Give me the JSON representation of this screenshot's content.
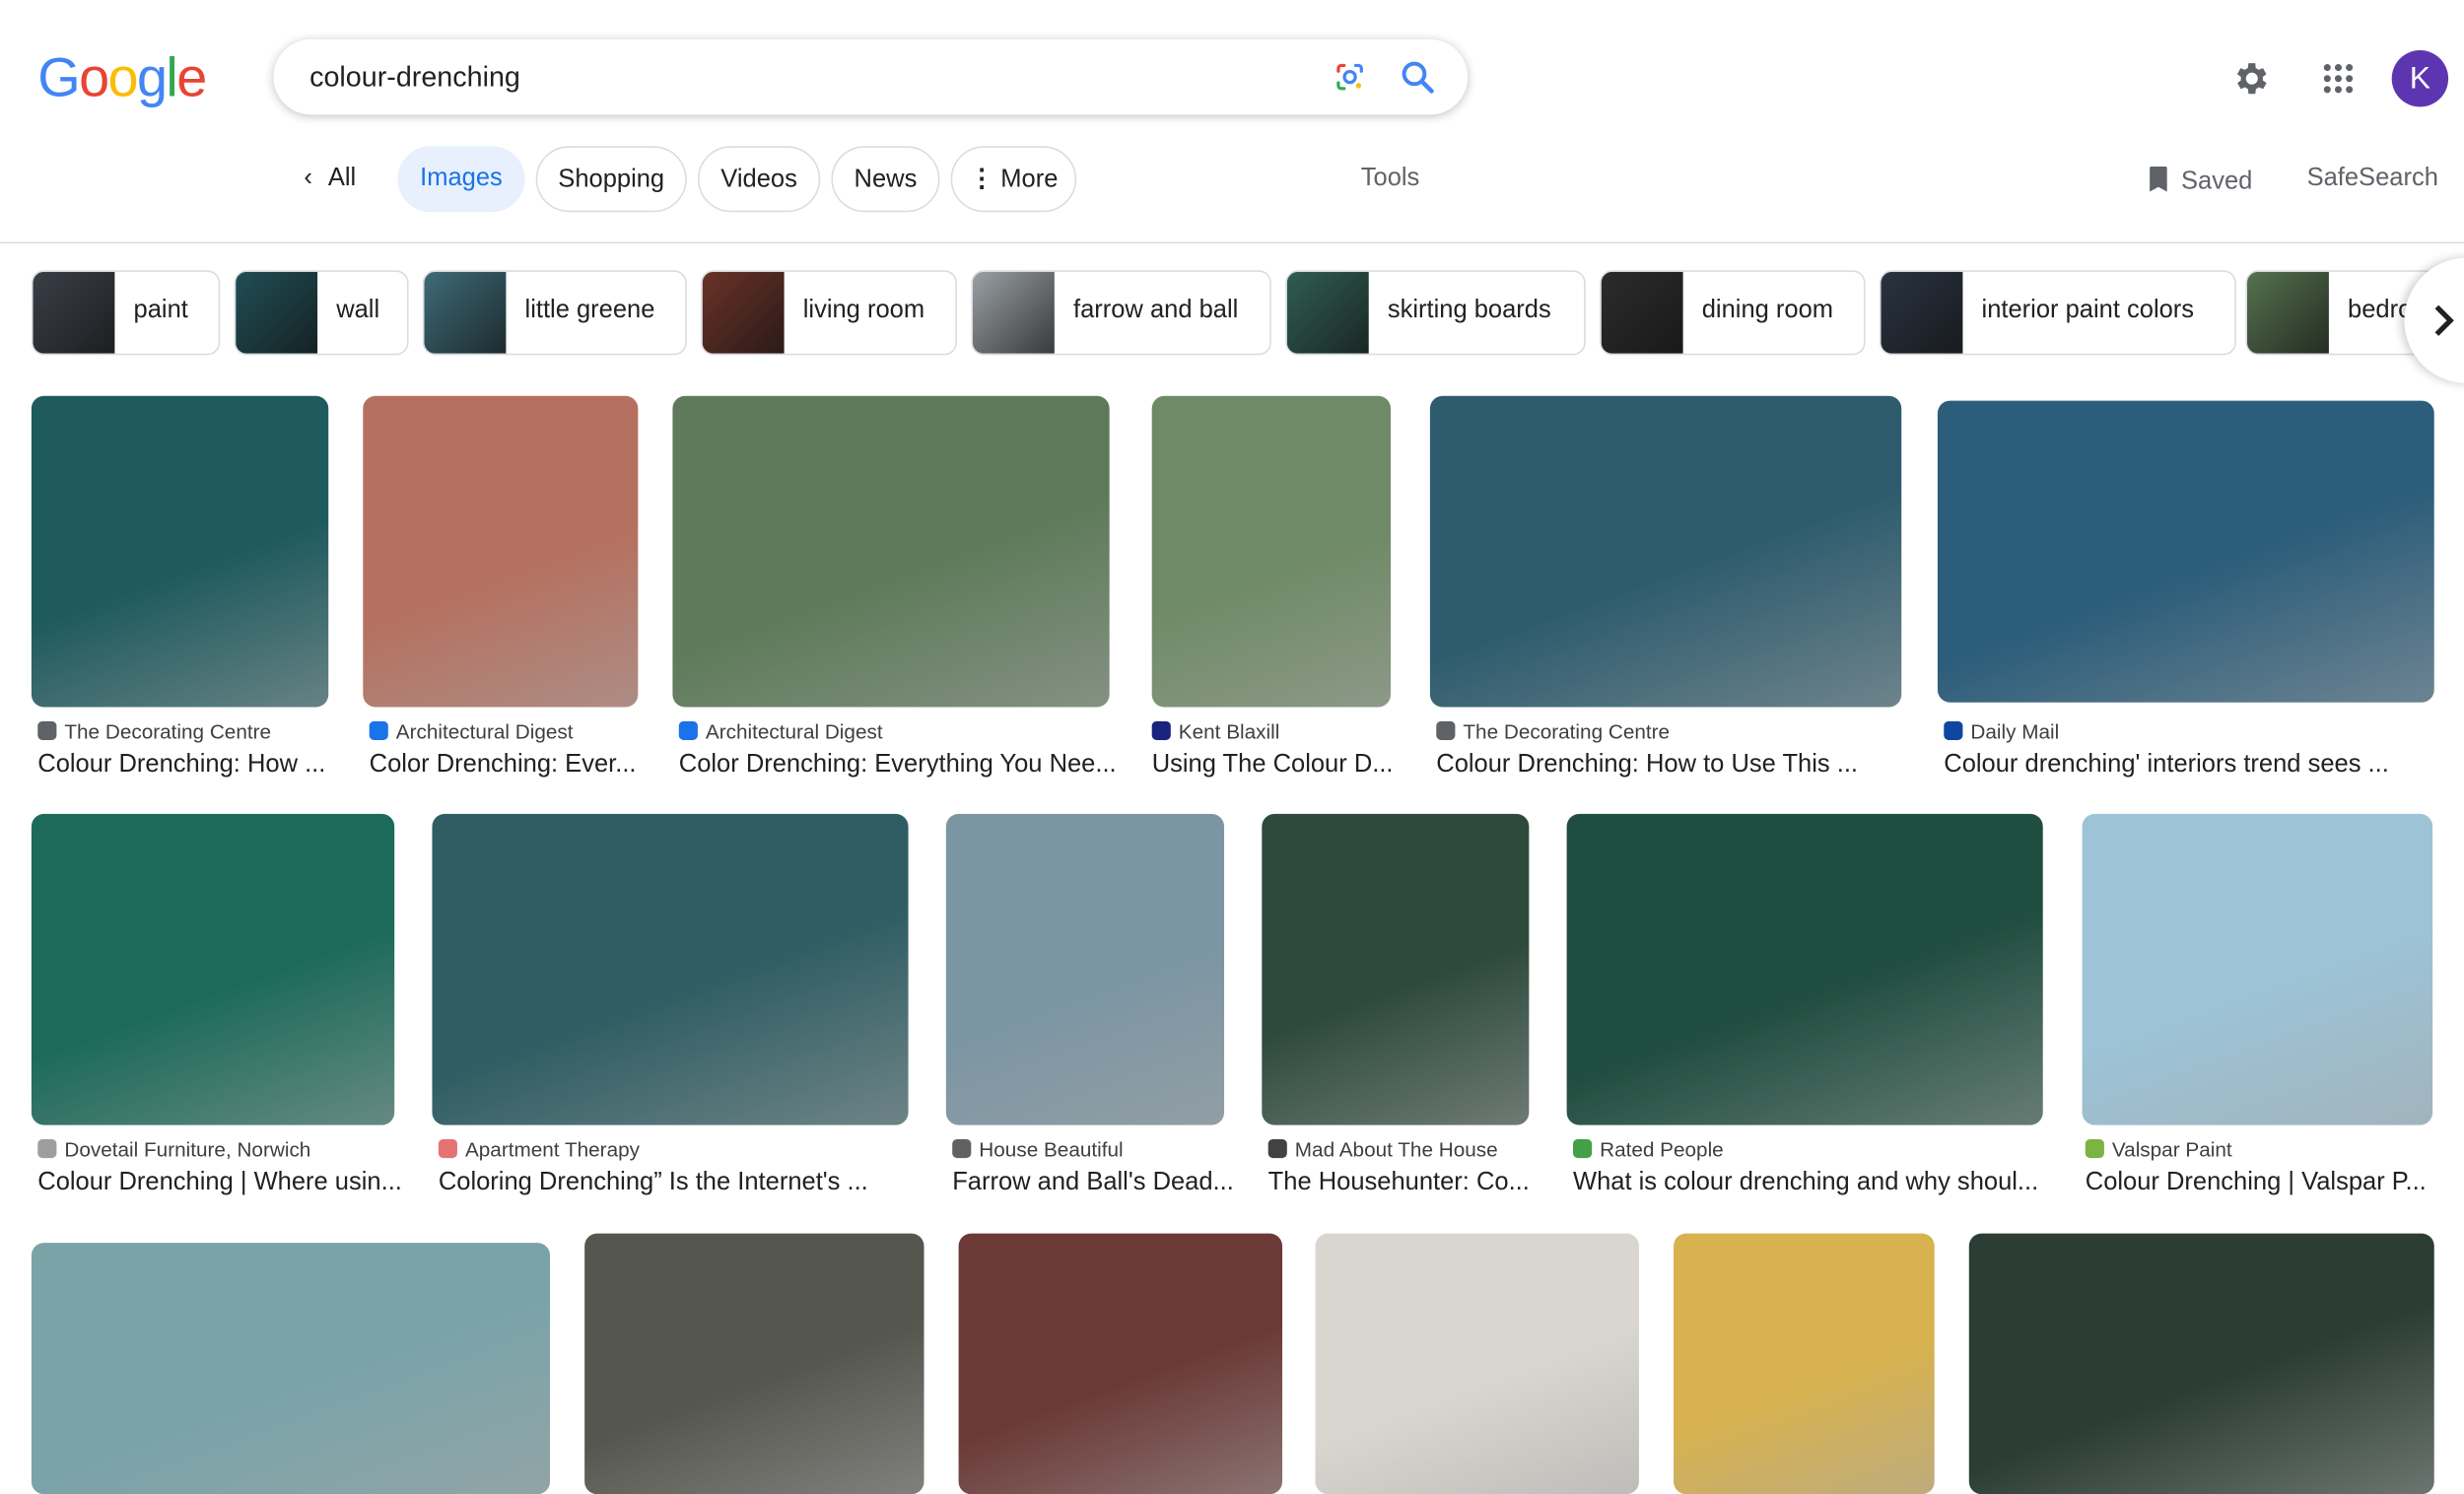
{
  "header": {
    "logo": "Google",
    "search_query": "colour-drenching",
    "avatar_letter": "K"
  },
  "tabs": [
    {
      "label": "All"
    },
    {
      "label": "Images"
    },
    {
      "label": "Shopping"
    },
    {
      "label": "Videos"
    },
    {
      "label": "News"
    },
    {
      "label": "More"
    }
  ],
  "toolbar": {
    "tools": "Tools",
    "saved": "Saved",
    "safesearch": "SafeSearch"
  },
  "chips": [
    {
      "label": "paint",
      "color": "#3a3f47"
    },
    {
      "label": "wall",
      "color": "#1f4e55"
    },
    {
      "label": "little greene",
      "color": "#3d6b78"
    },
    {
      "label": "living room",
      "color": "#6a3228"
    },
    {
      "label": "farrow and ball",
      "color": "#9aa0a4"
    },
    {
      "label": "skirting boards",
      "color": "#2f5d52"
    },
    {
      "label": "dining room",
      "color": "#2b2c2b"
    },
    {
      "label": "interior paint colors",
      "color": "#2a3340"
    },
    {
      "label": "bedro",
      "color": "#55724f"
    }
  ],
  "results": [
    {
      "source": "The Decorating Centre",
      "title": "Colour Drenching: How ...",
      "color": "#1f5a5e",
      "fav": "#5f6368"
    },
    {
      "source": "Architectural Digest",
      "title": "Color Drenching: Ever...",
      "color": "#b5705f",
      "fav": "#1a73e8"
    },
    {
      "source": "Architectural Digest",
      "title": "Color Drenching: Everything You Nee...",
      "color": "#5e7a5a",
      "fav": "#1a73e8"
    },
    {
      "source": "Kent Blaxill",
      "title": "Using The Colour D...",
      "color": "#6f8a66",
      "fav": "#1a237e"
    },
    {
      "source": "The Decorating Centre",
      "title": "Colour Drenching: How to Use This ...",
      "color": "#2e5c6e",
      "fav": "#5f6368"
    },
    {
      "source": "Daily Mail",
      "title": "Colour drenching' interiors trend sees ...",
      "color": "#2c5d7a",
      "fav": "#0d47a1"
    },
    {
      "source": "Dovetail Furniture, Norwich",
      "title": "Colour Drenching | Where usin...",
      "color": "#1c6a5a",
      "fav": "#9e9e9e"
    },
    {
      "source": "Apartment Therapy",
      "title": "Coloring Drenching” Is the Internet's ...",
      "color": "#2f5d63",
      "fav": "#e57373"
    },
    {
      "source": "House Beautiful",
      "title": "Farrow and Ball's Dead...",
      "color": "#7b95a3",
      "fav": "#616161"
    },
    {
      "source": "Mad About The House",
      "title": "The Househunter: Co...",
      "color": "#2e4a3d",
      "fav": "#424242"
    },
    {
      "source": "Rated People",
      "title": "What is colour drenching and why shoul...",
      "color": "#1f4d3f",
      "fav": "#43a047"
    },
    {
      "source": "Valspar Paint",
      "title": "Colour Drenching | Valspar P...",
      "color": "#9cc3d6",
      "fav": "#7cb342"
    },
    {
      "color": "#7aa3a8"
    },
    {
      "color": "#55574f"
    },
    {
      "color": "#6b3a37"
    },
    {
      "color": "#d8d6cf"
    },
    {
      "color": "#d8b24e"
    },
    {
      "color": "#2b3d34"
    }
  ]
}
